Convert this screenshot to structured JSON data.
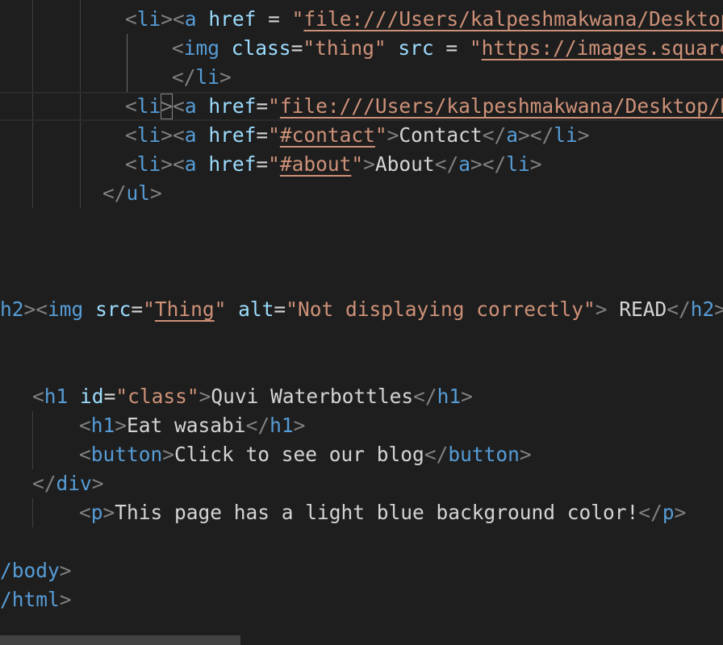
{
  "editor": {
    "lines": [
      {
        "id": "l1",
        "segments": [
          {
            "c": "t",
            "v": "<"
          },
          {
            "c": "tg",
            "v": "li"
          },
          {
            "c": "t",
            "v": "><"
          },
          {
            "c": "tg",
            "v": "a"
          },
          {
            "c": "tx",
            "v": " "
          },
          {
            "c": "at",
            "v": "href"
          },
          {
            "c": "tx",
            "v": " = "
          },
          {
            "c": "st",
            "v": "\""
          },
          {
            "c": "st ul",
            "v": "file:///Users/kalpeshmakwana/Desktop/"
          }
        ]
      },
      {
        "id": "l2",
        "segments": [
          {
            "c": "t",
            "v": "<"
          },
          {
            "c": "tg",
            "v": "img"
          },
          {
            "c": "tx",
            "v": " "
          },
          {
            "c": "at",
            "v": "class"
          },
          {
            "c": "tx",
            "v": "="
          },
          {
            "c": "st",
            "v": "\"thing\""
          },
          {
            "c": "tx",
            "v": " "
          },
          {
            "c": "at",
            "v": "src"
          },
          {
            "c": "tx",
            "v": " = "
          },
          {
            "c": "st",
            "v": "\""
          },
          {
            "c": "st ul",
            "v": "https://images.squares"
          }
        ]
      },
      {
        "id": "l3",
        "segments": [
          {
            "c": "t",
            "v": "</"
          },
          {
            "c": "tg",
            "v": "li"
          },
          {
            "c": "t",
            "v": ">"
          }
        ]
      },
      {
        "id": "l4",
        "segments": [
          {
            "c": "t",
            "v": "<"
          },
          {
            "c": "tg",
            "v": "li"
          },
          {
            "c": "t bracket",
            "v": ">"
          },
          {
            "c": "t",
            "v": "<"
          },
          {
            "c": "tg",
            "v": "a"
          },
          {
            "c": "tx",
            "v": " "
          },
          {
            "c": "at",
            "v": "href"
          },
          {
            "c": "tx",
            "v": "="
          },
          {
            "c": "st",
            "v": "\""
          },
          {
            "c": "st ul",
            "v": "file:///Users/kalpeshmakwana/Desktop/Nc"
          }
        ]
      },
      {
        "id": "l5",
        "segments": [
          {
            "c": "t",
            "v": "<"
          },
          {
            "c": "tg",
            "v": "li"
          },
          {
            "c": "t",
            "v": "><"
          },
          {
            "c": "tg",
            "v": "a"
          },
          {
            "c": "tx",
            "v": " "
          },
          {
            "c": "at",
            "v": "href"
          },
          {
            "c": "tx",
            "v": "="
          },
          {
            "c": "st",
            "v": "\""
          },
          {
            "c": "st ul",
            "v": "#contact"
          },
          {
            "c": "st",
            "v": "\""
          },
          {
            "c": "t",
            "v": ">"
          },
          {
            "c": "tx",
            "v": "Contact"
          },
          {
            "c": "t",
            "v": "</"
          },
          {
            "c": "tg",
            "v": "a"
          },
          {
            "c": "t",
            "v": "></"
          },
          {
            "c": "tg",
            "v": "li"
          },
          {
            "c": "t",
            "v": ">"
          }
        ]
      },
      {
        "id": "l6",
        "segments": [
          {
            "c": "t",
            "v": "<"
          },
          {
            "c": "tg",
            "v": "li"
          },
          {
            "c": "t",
            "v": "><"
          },
          {
            "c": "tg",
            "v": "a"
          },
          {
            "c": "tx",
            "v": " "
          },
          {
            "c": "at",
            "v": "href"
          },
          {
            "c": "tx",
            "v": "="
          },
          {
            "c": "st",
            "v": "\""
          },
          {
            "c": "st ul",
            "v": "#about"
          },
          {
            "c": "st",
            "v": "\""
          },
          {
            "c": "t",
            "v": ">"
          },
          {
            "c": "tx",
            "v": "About"
          },
          {
            "c": "t",
            "v": "</"
          },
          {
            "c": "tg",
            "v": "a"
          },
          {
            "c": "t",
            "v": "></"
          },
          {
            "c": "tg",
            "v": "li"
          },
          {
            "c": "t",
            "v": ">"
          }
        ]
      },
      {
        "id": "l7",
        "segments": [
          {
            "c": "t",
            "v": "</"
          },
          {
            "c": "tg",
            "v": "ul"
          },
          {
            "c": "t",
            "v": ">"
          }
        ]
      },
      {
        "id": "l8",
        "segments": [
          {
            "c": "tg",
            "v": "h2"
          },
          {
            "c": "t",
            "v": "><"
          },
          {
            "c": "tg",
            "v": "img"
          },
          {
            "c": "tx",
            "v": " "
          },
          {
            "c": "at",
            "v": "src"
          },
          {
            "c": "tx",
            "v": "="
          },
          {
            "c": "st",
            "v": "\""
          },
          {
            "c": "st ul",
            "v": "Thing"
          },
          {
            "c": "st",
            "v": "\""
          },
          {
            "c": "tx",
            "v": " "
          },
          {
            "c": "at",
            "v": "alt"
          },
          {
            "c": "tx",
            "v": "="
          },
          {
            "c": "st",
            "v": "\"Not displaying correctly\""
          },
          {
            "c": "t",
            "v": ">"
          },
          {
            "c": "tx",
            "v": " READ"
          },
          {
            "c": "t",
            "v": "</"
          },
          {
            "c": "tg",
            "v": "h2"
          },
          {
            "c": "t",
            "v": ">"
          }
        ]
      },
      {
        "id": "l9",
        "segments": [
          {
            "c": "t",
            "v": "<"
          },
          {
            "c": "tg",
            "v": "h1"
          },
          {
            "c": "tx",
            "v": " "
          },
          {
            "c": "at",
            "v": "id"
          },
          {
            "c": "tx",
            "v": "="
          },
          {
            "c": "st",
            "v": "\"class\""
          },
          {
            "c": "t",
            "v": ">"
          },
          {
            "c": "tx",
            "v": "Quvi Waterbottles"
          },
          {
            "c": "t",
            "v": "</"
          },
          {
            "c": "tg",
            "v": "h1"
          },
          {
            "c": "t",
            "v": ">"
          }
        ]
      },
      {
        "id": "l10",
        "segments": [
          {
            "c": "t",
            "v": "<"
          },
          {
            "c": "tg",
            "v": "h1"
          },
          {
            "c": "t",
            "v": ">"
          },
          {
            "c": "tx",
            "v": "Eat wasabi"
          },
          {
            "c": "t",
            "v": "</"
          },
          {
            "c": "tg",
            "v": "h1"
          },
          {
            "c": "t",
            "v": ">"
          }
        ]
      },
      {
        "id": "l11",
        "segments": [
          {
            "c": "t",
            "v": "<"
          },
          {
            "c": "tg",
            "v": "button"
          },
          {
            "c": "t",
            "v": ">"
          },
          {
            "c": "tx",
            "v": "Click to see our blog"
          },
          {
            "c": "t",
            "v": "</"
          },
          {
            "c": "tg",
            "v": "button"
          },
          {
            "c": "t",
            "v": ">"
          }
        ]
      },
      {
        "id": "l12",
        "segments": [
          {
            "c": "t",
            "v": "</"
          },
          {
            "c": "tg",
            "v": "div"
          },
          {
            "c": "t",
            "v": ">"
          }
        ]
      },
      {
        "id": "l13",
        "segments": [
          {
            "c": "t",
            "v": "<"
          },
          {
            "c": "tg",
            "v": "p"
          },
          {
            "c": "t",
            "v": ">"
          },
          {
            "c": "tx",
            "v": "This page has a light blue background color!"
          },
          {
            "c": "t",
            "v": "</"
          },
          {
            "c": "tg",
            "v": "p"
          },
          {
            "c": "t",
            "v": ">"
          }
        ]
      },
      {
        "id": "l14",
        "segments": [
          {
            "c": "tg",
            "v": "/body"
          },
          {
            "c": "t",
            "v": ">"
          }
        ]
      },
      {
        "id": "l15",
        "segments": [
          {
            "c": "tg",
            "v": "/html"
          },
          {
            "c": "t",
            "v": ">"
          }
        ]
      }
    ]
  },
  "colors": {
    "background": "#1e1e1e",
    "tag": "#569cd6",
    "attribute": "#9cdcfe",
    "string": "#ce9178",
    "punctuation": "#808080",
    "text": "#d4d4d4"
  }
}
